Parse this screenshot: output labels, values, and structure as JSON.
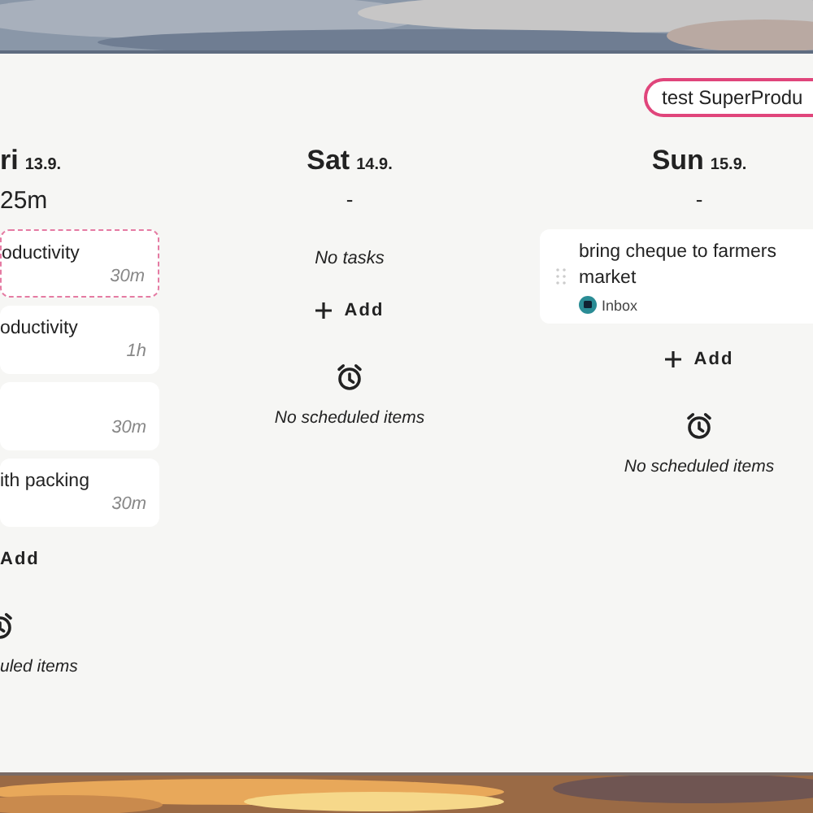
{
  "search": {
    "value": "test SuperProdu"
  },
  "days": [
    {
      "name": "ri",
      "date": "13.9.",
      "total": "25m",
      "tasks": [
        {
          "title": "oductivity",
          "duration": "30m",
          "selected": true
        },
        {
          "title": "oductivity",
          "duration": "1h",
          "selected": false
        },
        {
          "duration": "30m",
          "selected": false
        },
        {
          "title": "ith packing",
          "duration": "30m",
          "selected": false
        }
      ],
      "add": "Add",
      "scheduled": "uled items"
    },
    {
      "name": "Sat",
      "date": "14.9.",
      "total": "-",
      "empty": "No tasks",
      "add": "Add",
      "scheduled": "No scheduled items"
    },
    {
      "name": "Sun",
      "date": "15.9.",
      "total": "-",
      "tasks": [
        {
          "title": "bring cheque to farmers market",
          "project": "Inbox"
        }
      ],
      "add": "Add",
      "scheduled": "No scheduled items"
    }
  ]
}
